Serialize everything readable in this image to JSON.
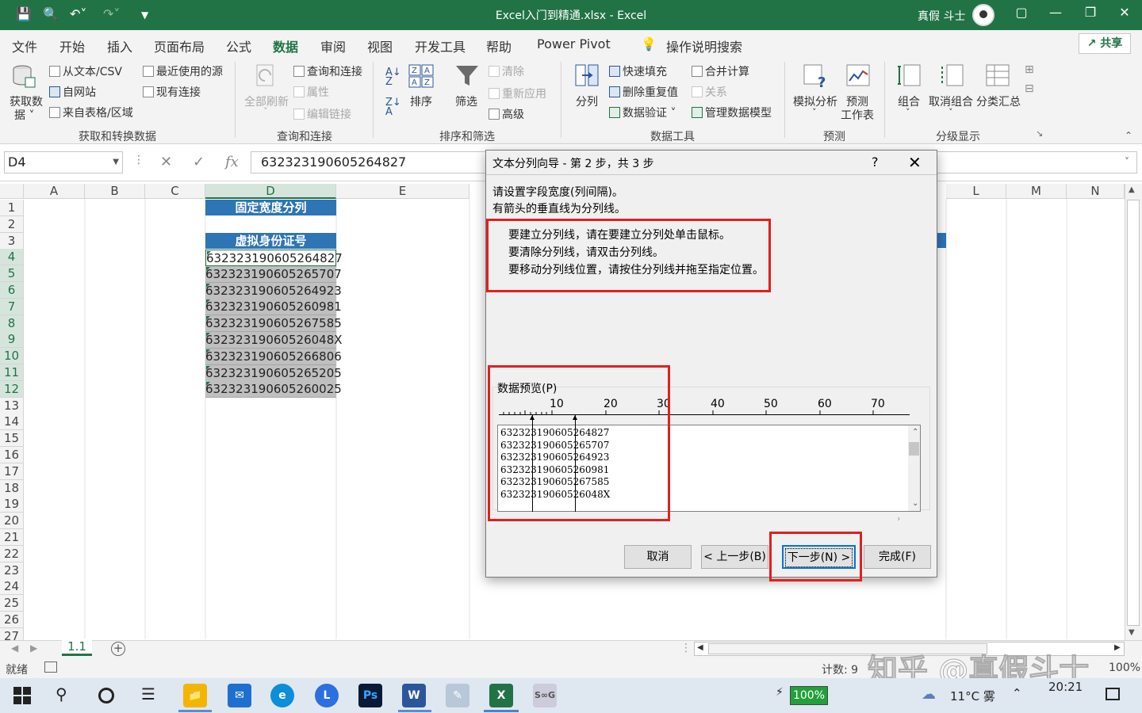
{
  "titlebar": {
    "title": "Excel入门到精通.xlsx  -  Excel",
    "user": "真假 斗士",
    "quick_access": [
      "save-icon",
      "print-preview-icon",
      "undo-icon",
      "redo-icon",
      "customize-icon"
    ]
  },
  "tabs": [
    "文件",
    "开始",
    "插入",
    "页面布局",
    "公式",
    "数据",
    "审阅",
    "视图",
    "开发工具",
    "帮助",
    "Power Pivot"
  ],
  "active_tab": "数据",
  "tell_me": "操作说明搜索",
  "share": "共享",
  "ribbon": {
    "get_data": {
      "big_label_1": "获取数",
      "big_label_2": "据",
      "items": [
        "从文本/CSV",
        "自网站",
        "来自表格/区域",
        "最近使用的源",
        "现有连接"
      ],
      "group": "获取和转换数据"
    },
    "query": {
      "refresh": "全部刷新",
      "items": [
        "查询和连接",
        "属性",
        "编辑链接"
      ],
      "group": "查询和连接"
    },
    "sort_filter": {
      "sort": "排序",
      "filter": "筛选",
      "items": [
        "清除",
        "重新应用",
        "高级"
      ],
      "group": "排序和筛选"
    },
    "data_tools": {
      "split": "分列",
      "items": [
        "快速填充",
        "删除重复值",
        "数据验证",
        "合并计算",
        "关系",
        "管理数据模型"
      ],
      "group": "数据工具"
    },
    "forecast": {
      "whatif": "模拟分析",
      "sheet_1": "预测",
      "sheet_2": "工作表",
      "group": "预测"
    },
    "outline": {
      "items": [
        "组合",
        "取消组合",
        "分类汇总"
      ],
      "group": "分级显示"
    }
  },
  "formula_bar": {
    "name_box": "D4",
    "value": "632323190605264827",
    "fx": "fx"
  },
  "columns": [
    "A",
    "B",
    "C",
    "D",
    "E",
    "L",
    "M",
    "N"
  ],
  "rows": [
    "1",
    "2",
    "3",
    "4",
    "5",
    "6",
    "7",
    "8",
    "9",
    "10",
    "11",
    "12",
    "13",
    "14",
    "15",
    "16",
    "17",
    "18",
    "19",
    "20",
    "21",
    "22",
    "23",
    "24",
    "25",
    "26",
    "27"
  ],
  "sheet": {
    "title_cell": "固定宽度分列",
    "header_cell": "虚拟身份证号",
    "ids": [
      "632323190605264827",
      "632323190605265707",
      "632323190605264923",
      "632323190605260981",
      "632323190605267585",
      "63232319060526048X",
      "632323190605266806",
      "632323190605265205",
      "632323190605260025"
    ]
  },
  "sheet_tab": "1.1",
  "status": {
    "ready": "就绪",
    "count": "计数: 9",
    "zoom": "100%"
  },
  "dialog": {
    "title": "文本分列向导 - 第 2 步，共 3 步",
    "help": "?",
    "line1": "请设置字段宽度(列间隔)。",
    "line2": "有箭头的垂直线为分列线。",
    "instructions": [
      "要建立分列线，请在要建立分列处单击鼠标。",
      "要清除分列线，请双击分列线。",
      "要移动分列线位置，请按住分列线并拖至指定位置。"
    ],
    "preview_label": "数据预览(P)",
    "ruler": [
      "10",
      "20",
      "30",
      "40",
      "50",
      "60",
      "70"
    ],
    "preview_rows": [
      "632323190605264827",
      "632323190605265707",
      "632323190605264923",
      "632323190605260981",
      "632323190605267585",
      "63232319060526048X"
    ],
    "buttons": {
      "cancel": "取消",
      "back": "< 上一步(B)",
      "next": "下一步(N) >",
      "finish": "完成(F)"
    }
  },
  "taskbar": {
    "battery": "100%",
    "weather": "11°C 雾",
    "time": "20:21"
  },
  "watermark": "知乎 @真假斗士",
  "colors": {
    "excel_green": "#217346",
    "header_blue": "#2e75b6",
    "highlight_red": "#e02020"
  }
}
